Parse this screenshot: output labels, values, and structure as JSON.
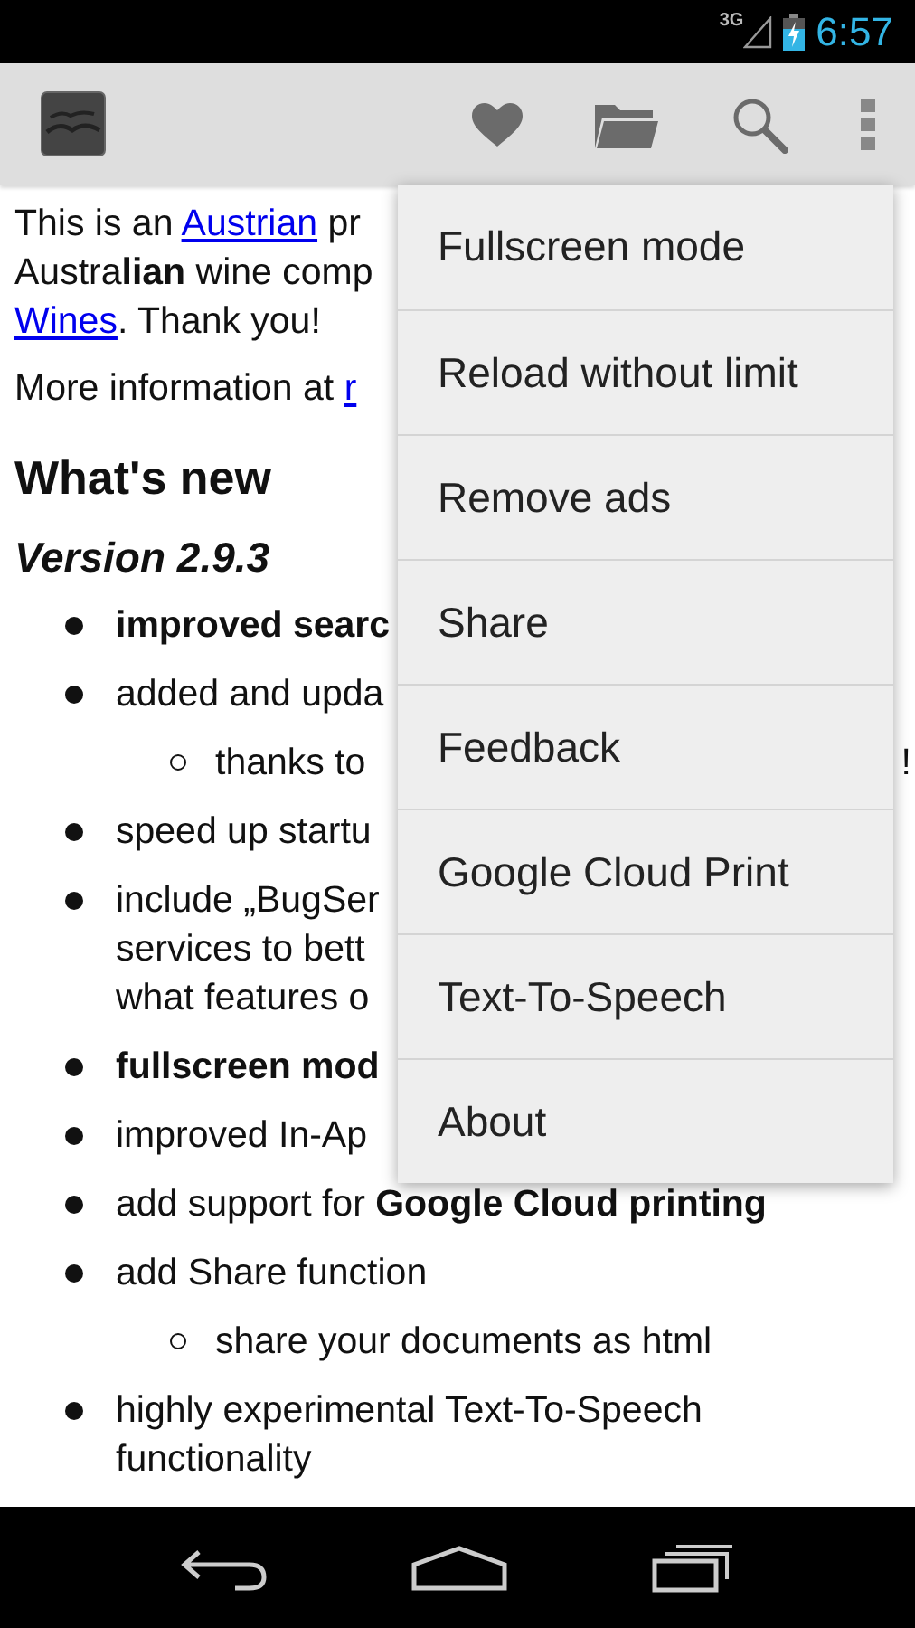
{
  "status_bar": {
    "network": "3G",
    "time": "6:57"
  },
  "document": {
    "paragraphs": [
      {
        "lines": [
          [
            {
              "kind": "text",
              "text": "This is an "
            },
            {
              "kind": "link",
              "text": "Austrian"
            },
            {
              "kind": "text",
              "text": " pr"
            }
          ],
          [
            {
              "kind": "text",
              "text": "Austra**lian** wine comp"
            }
          ],
          [
            {
              "kind": "link",
              "text": "Wines"
            },
            {
              "kind": "text",
              "text": ". Thank you!"
            }
          ]
        ]
      },
      {
        "lines": [
          [
            {
              "kind": "text",
              "text": "More information at "
            },
            {
              "kind": "link",
              "text": "r"
            }
          ]
        ]
      }
    ],
    "heading": "What's new",
    "version": "Version 2.9.3",
    "items": [
      {
        "text": "**improved searc**"
      },
      {
        "text": "added and upda",
        "children": [
          {
            "text": "thanks to",
            "line_end": "!"
          }
        ]
      },
      {
        "text": "speed up startu"
      },
      {
        "text": "include „BugSer\nservices to bett\nwhat features o"
      },
      {
        "text": "**fullscreen mod**"
      },
      {
        "text": "improved In-Ap"
      },
      {
        "text": "add support for **Google Cloud printing**"
      },
      {
        "text": "add Share function",
        "children": [
          {
            "text": "share your documents as html"
          }
        ]
      },
      {
        "text": "highly experimental Text-To-Speech functionality"
      }
    ]
  },
  "menu": {
    "items": [
      "Fullscreen mode",
      "Reload without limit",
      "Remove ads",
      "Share",
      "Feedback",
      "Google Cloud Print",
      "Text-To-Speech",
      "About"
    ]
  }
}
